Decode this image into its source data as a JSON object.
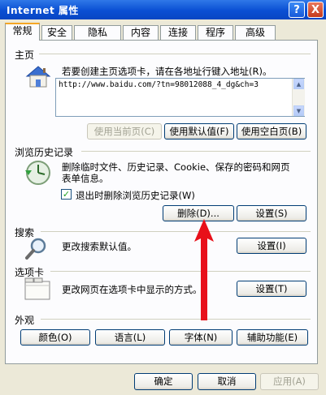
{
  "window": {
    "title": "Internet 属性",
    "help_glyph": "?",
    "close_glyph": "X"
  },
  "tabs": [
    "常规",
    "安全",
    "隐私",
    "内容",
    "连接",
    "程序",
    "高级"
  ],
  "active_tab": "常规",
  "homepage": {
    "title": "主页",
    "description": "若要创建主页选项卡，请在各地址行键入地址(R)。",
    "url": "http://www.baidu.com/?tn=98012088_4_dg&ch=3",
    "buttons": {
      "use_current": "使用当前页(C)",
      "use_default": "使用默认值(F)",
      "use_blank": "使用空白页(B)"
    }
  },
  "history": {
    "title": "浏览历史记录",
    "description_line1": "删除临时文件、历史记录、Cookie、保存的密码和网页",
    "description_line2": "表单信息。",
    "checkbox_label": "退出时删除浏览历史记录(W)",
    "checkbox_checked": true,
    "checkbox_glyph": "✓",
    "delete_label": "删除(D)...",
    "settings_label": "设置(S)"
  },
  "search": {
    "title": "搜索",
    "description": "更改搜索默认值。",
    "settings_label": "设置(I)"
  },
  "tabsection": {
    "title": "选项卡",
    "description": "更改网页在选项卡中显示的方式。",
    "settings_label": "设置(T)"
  },
  "appearance": {
    "title": "外观",
    "buttons": [
      "颜色(O)",
      "语言(L)",
      "字体(N)",
      "辅助功能(E)"
    ]
  },
  "footer": {
    "ok": "确定",
    "cancel": "取消",
    "apply": "应用(A)"
  },
  "colors": {
    "titlebar": "#0a4fd3",
    "annotation_arrow": "#e8101a",
    "tab_highlight": "#f5a624"
  }
}
